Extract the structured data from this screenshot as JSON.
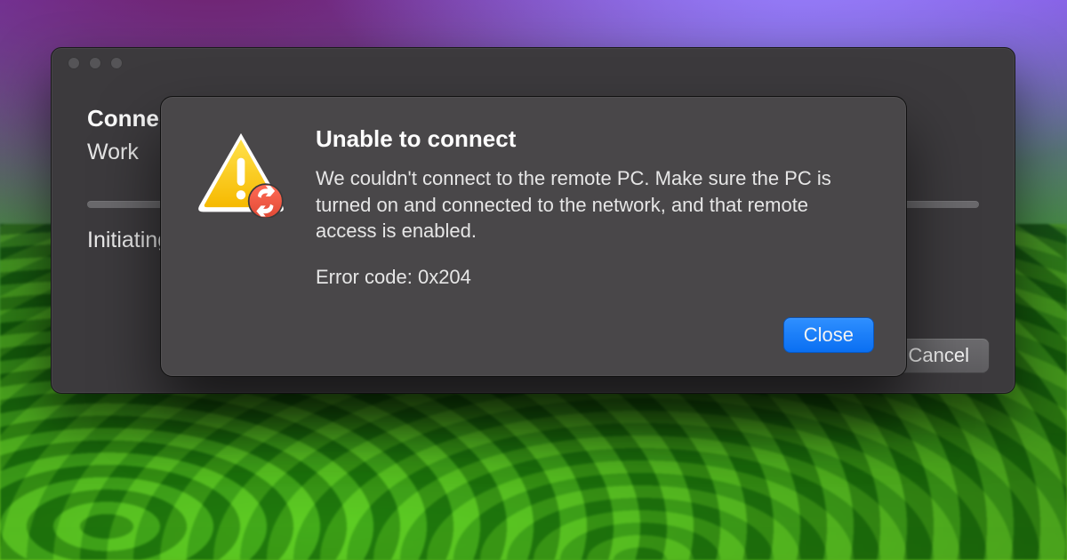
{
  "window": {
    "heading_prefix": "Connecting to",
    "target": "Work",
    "status": "Initiating remote connection…",
    "cancel_label": "Cancel"
  },
  "dialog": {
    "title": "Unable to connect",
    "message": "We couldn't connect to the remote PC. Make sure the PC is turned on and connected to the network, and that remote access is enabled.",
    "error_code_label": "Error code:",
    "error_code_value": "0x204",
    "close_label": "Close",
    "icon": "warning-triangle",
    "badge_icon": "remote-desktop"
  }
}
